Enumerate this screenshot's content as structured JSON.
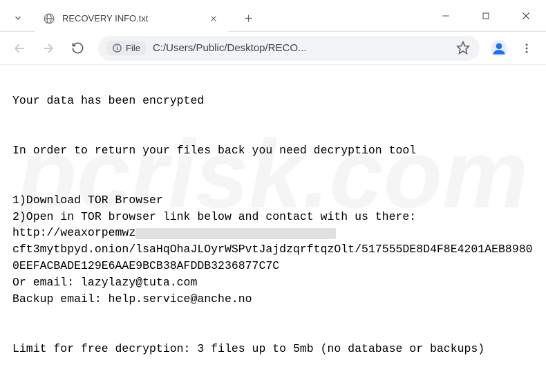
{
  "tab": {
    "title": "RECOVERY INFO.txt"
  },
  "address": {
    "file_label": "File",
    "url": "C:/Users/Public/Desktop/RECO..."
  },
  "content": {
    "line1": "Your data has been encrypted",
    "line2": "In order to return your files back you need decryption tool",
    "line3": "1)Download TOR Browser",
    "line4": "2)Open in TOR browser link below and contact with us there:",
    "url_prefix": "http://weaxorpemwz",
    "url_suffix": "cft3mytbpyd.onion",
    "url_path": "/lsaHqOhaJLOyrWSPvtJajdzqrftqzOlt/517555DE8D4F8E4201AEB89800EEFACBADE129E6AAE9BCB38AFDDB3236877C7C",
    "email1_label": "Or email: ",
    "email1": "lazylazy@tuta.com",
    "email2_label": "Backup email: ",
    "email2": "help.service@anche.no",
    "limit": "Limit for free decryption: 3 files up to 5mb (no database or backups)"
  },
  "watermark": "pcrisk.com"
}
